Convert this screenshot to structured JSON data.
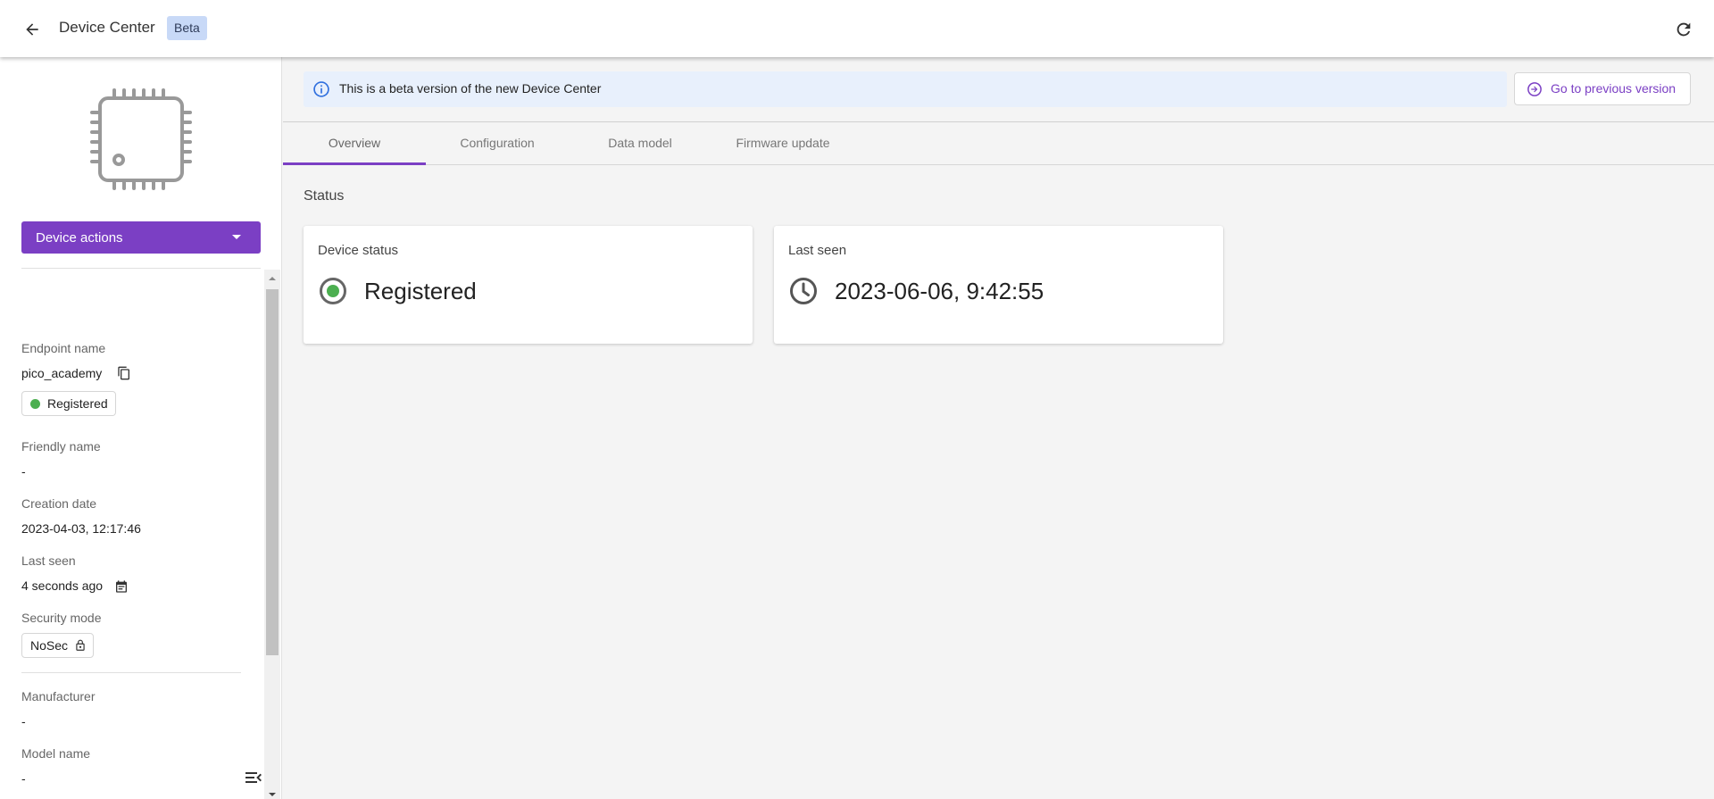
{
  "header": {
    "title": "Device Center",
    "badge": "Beta"
  },
  "sidebar": {
    "device_actions_label": "Device actions",
    "fields": {
      "endpoint_name_label": "Endpoint name",
      "endpoint_name_value": "pico_academy",
      "status_chip": "Registered",
      "friendly_name_label": "Friendly name",
      "friendly_name_value": "-",
      "creation_date_label": "Creation date",
      "creation_date_value": "2023-04-03, 12:17:46",
      "last_seen_label": "Last seen",
      "last_seen_value": "4 seconds ago",
      "security_mode_label": "Security mode",
      "security_mode_value": "NoSec",
      "manufacturer_label": "Manufacturer",
      "manufacturer_value": "-",
      "model_name_label": "Model name",
      "model_name_value": "-"
    }
  },
  "banner": {
    "message": "This is a beta version of the new Device Center",
    "prev_version_label": "Go to previous version"
  },
  "tabs": [
    {
      "label": "Overview"
    },
    {
      "label": "Configuration"
    },
    {
      "label": "Data model"
    },
    {
      "label": "Firmware update"
    }
  ],
  "status_section": {
    "title": "Status",
    "device_status": {
      "title": "Device status",
      "value": "Registered"
    },
    "last_seen": {
      "title": "Last seen",
      "value": "2023-06-06, 9:42:55"
    }
  },
  "colors": {
    "accent": "#7b3fc4",
    "status_green": "#4caf50",
    "banner_bg": "#e8f0fc",
    "badge_bg": "#c8d9f7"
  }
}
